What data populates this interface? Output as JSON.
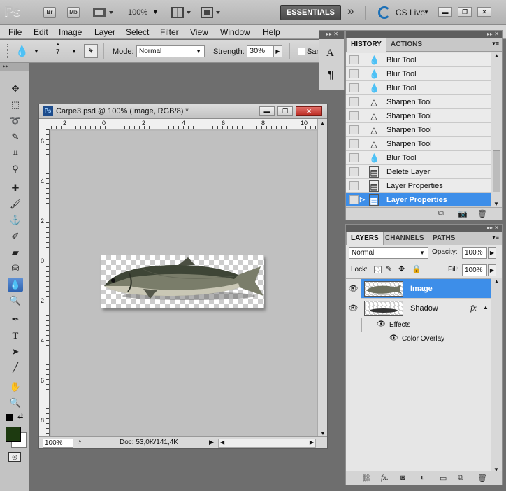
{
  "appbar": {
    "logo": "Ps",
    "bridge_label": "Br",
    "minibridge_label": "Mb",
    "zoom_value": "100%",
    "workspace_label": "ESSENTIALS",
    "more_label": "»",
    "cslive_label": "CS Live"
  },
  "menu": [
    "File",
    "Edit",
    "Image",
    "Layer",
    "Select",
    "Filter",
    "View",
    "Window",
    "Help"
  ],
  "options": {
    "brush_size": "7",
    "mode_label": "Mode:",
    "mode_value": "Normal",
    "strength_label": "Strength:",
    "strength_value": "30%",
    "sample_label": "Sam"
  },
  "document": {
    "title": "Carpe3.psd @ 100% (Image, RGB/8) *",
    "ruler_top": [
      "2",
      "0",
      "2",
      "4",
      "6",
      "8",
      "10"
    ],
    "ruler_left": [
      "6",
      "4",
      "2",
      "0",
      "2",
      "4",
      "6",
      "8"
    ],
    "zoom": "100%",
    "doc_size": "Doc: 53,0K/141,4K"
  },
  "char_panel": {
    "char_icon": "A|",
    "para_icon": "¶"
  },
  "history": {
    "tabs": [
      "HISTORY",
      "ACTIONS"
    ],
    "items": [
      {
        "label": "Blur Tool",
        "icon": "blur-icon",
        "glyph": "💧"
      },
      {
        "label": "Blur Tool",
        "icon": "blur-icon",
        "glyph": "💧"
      },
      {
        "label": "Blur Tool",
        "icon": "blur-icon",
        "glyph": "💧"
      },
      {
        "label": "Sharpen Tool",
        "icon": "sharpen-icon",
        "glyph": "△"
      },
      {
        "label": "Sharpen Tool",
        "icon": "sharpen-icon",
        "glyph": "△"
      },
      {
        "label": "Sharpen Tool",
        "icon": "sharpen-icon",
        "glyph": "△"
      },
      {
        "label": "Sharpen Tool",
        "icon": "sharpen-icon",
        "glyph": "△"
      },
      {
        "label": "Blur Tool",
        "icon": "blur-icon",
        "glyph": "💧"
      },
      {
        "label": "Delete Layer",
        "icon": "history-state-icon",
        "glyph": "▤"
      },
      {
        "label": "Layer Properties",
        "icon": "history-state-icon",
        "glyph": "▤"
      },
      {
        "label": "Layer Properties",
        "icon": "history-state-icon",
        "glyph": "▤",
        "selected": true
      }
    ]
  },
  "layers": {
    "tabs": [
      "LAYERS",
      "CHANNELS",
      "PATHS"
    ],
    "blend_mode": "Normal",
    "opacity_label": "Opacity:",
    "opacity_value": "100%",
    "lock_label": "Lock:",
    "fill_label": "Fill:",
    "fill_value": "100%",
    "items": [
      {
        "name": "Image",
        "selected": true
      },
      {
        "name": "Shadow",
        "fx": "fx"
      }
    ],
    "effects_label": "Effects",
    "effect_item": "Color Overlay"
  },
  "colors": {
    "foreground": "#1d3a10",
    "background": "#ffffff",
    "selection": "#3d8ee9"
  }
}
